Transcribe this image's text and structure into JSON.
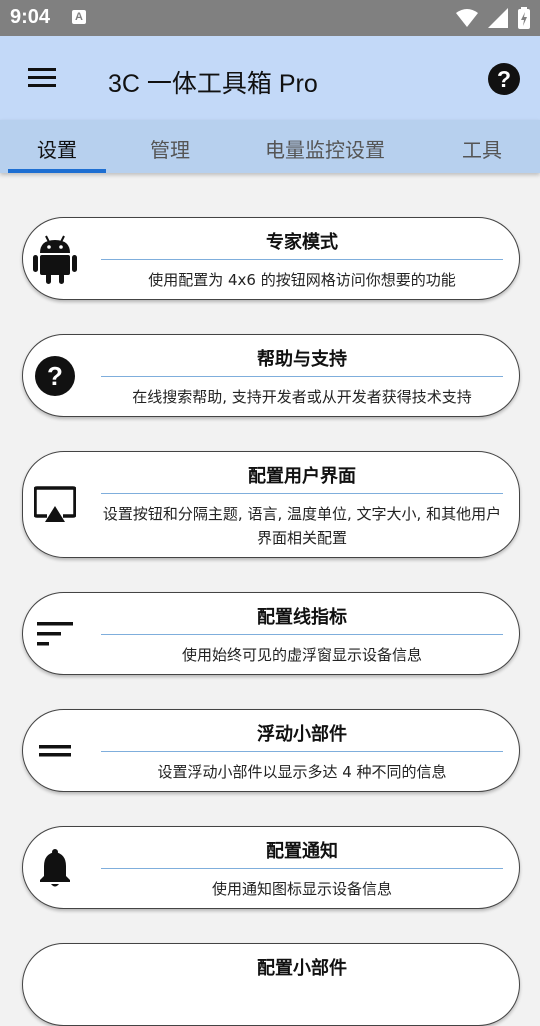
{
  "status_bar": {
    "time": "9:04",
    "notification_icon": "A"
  },
  "app_bar": {
    "title": "3C 一体工具箱 Pro",
    "help_label": "?"
  },
  "tabs": [
    {
      "label": "设置",
      "active": true
    },
    {
      "label": "管理",
      "active": false
    },
    {
      "label": "电量监控设置",
      "active": false
    },
    {
      "label": "工具",
      "active": false
    }
  ],
  "colors": {
    "app_bar": "#c3d9f8",
    "tab_bar": "#b7d0ee",
    "accent": "#1e6fd2",
    "status_bar": "#808080"
  },
  "cards": [
    {
      "icon": "android-icon",
      "title": "专家模式",
      "desc": "使用配置为 4x6 的按钮网格访问你想要的功能"
    },
    {
      "icon": "help-circle-icon",
      "title": "帮助与支持",
      "desc": "在线搜索帮助, 支持开发者或从开发者获得技术支持"
    },
    {
      "icon": "cast-screen-icon",
      "title": "配置用户界面",
      "desc": "设置按钮和分隔主题, 语言, 温度单位, 文字大小, 和其他用户界面相关配置"
    },
    {
      "icon": "sort-lines-icon",
      "title": "配置线指标",
      "desc": "使用始终可见的虚浮窗显示设备信息"
    },
    {
      "icon": "equals-icon",
      "title": "浮动小部件",
      "desc": "设置浮动小部件以显示多达 4 种不同的信息"
    },
    {
      "icon": "bell-icon",
      "title": "配置通知",
      "desc": "使用通知图标显示设备信息"
    },
    {
      "icon": "widget-icon",
      "title": "配置小部件",
      "desc": ""
    }
  ]
}
